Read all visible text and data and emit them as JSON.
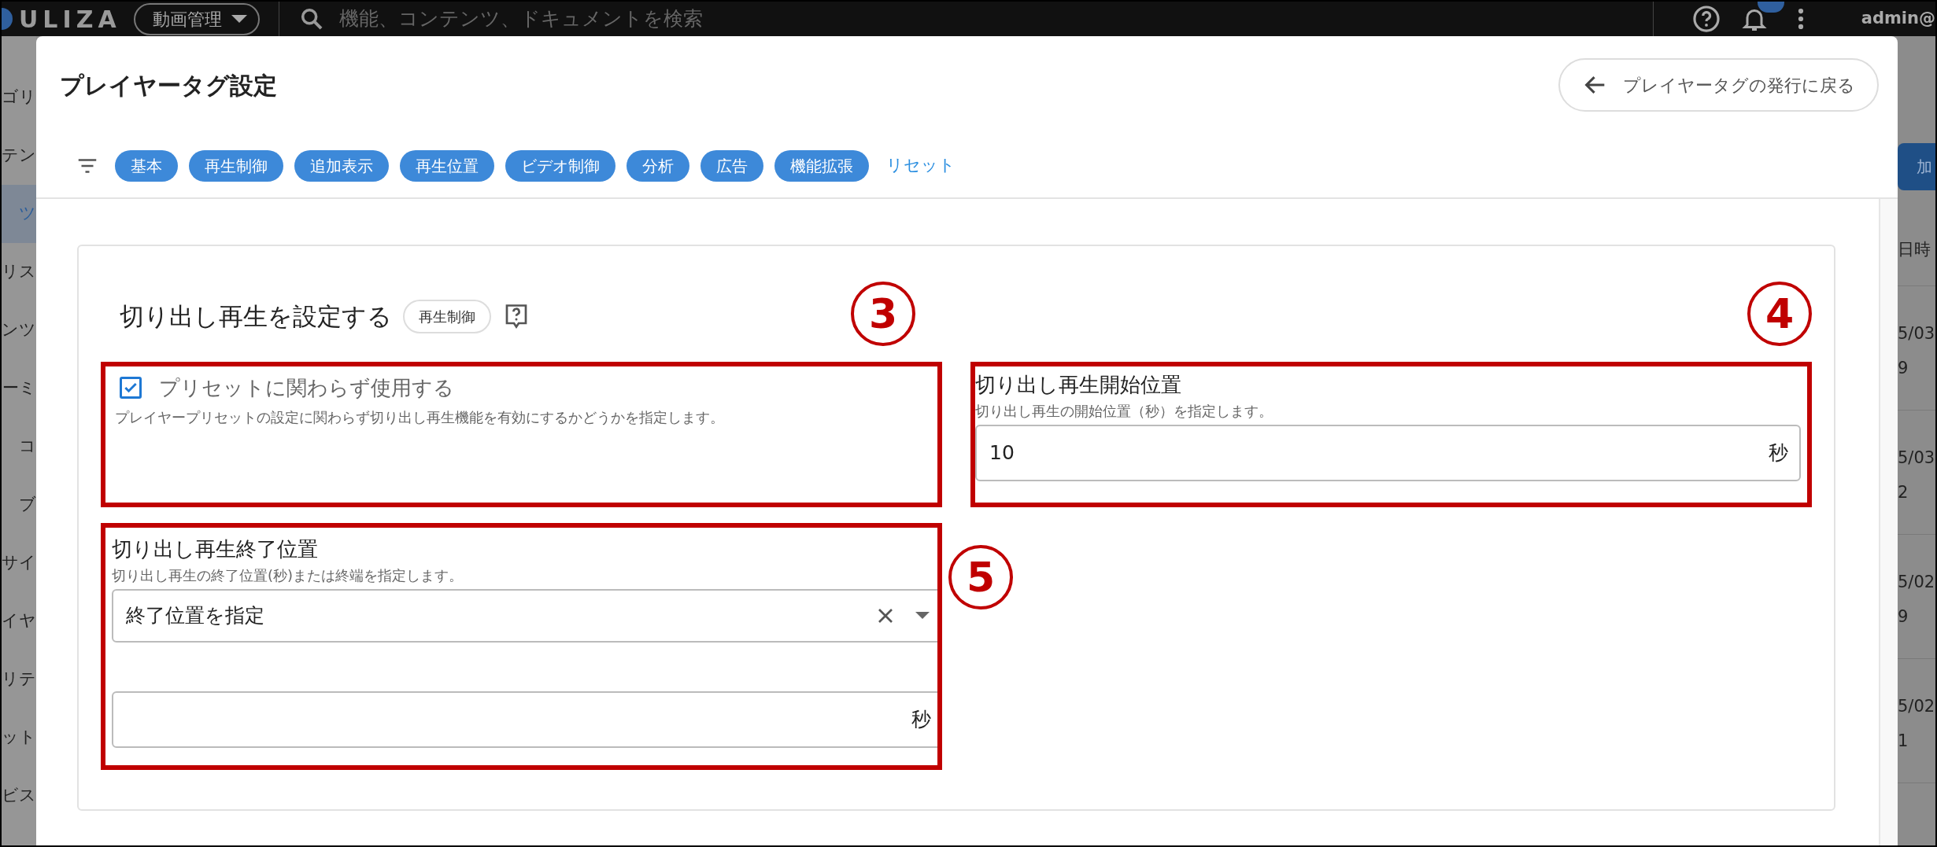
{
  "top_bar": {
    "logo": "ULIZA",
    "service_menu": "動画管理",
    "search": {
      "placeholder": "機能、コンテンツ、ドキュメントを検索"
    },
    "user": "admin@"
  },
  "sidebar": {
    "items": [
      {
        "label": "ゴリ",
        "selected": false
      },
      {
        "label": "テン",
        "selected": false
      },
      {
        "label": "ツ",
        "selected": true
      },
      {
        "label": "リス",
        "selected": false
      },
      {
        "label": "ンツ",
        "selected": false
      },
      {
        "label": "ーミ",
        "selected": false
      },
      {
        "label": "コ",
        "selected": false
      },
      {
        "label": "ブ",
        "selected": false
      },
      {
        "label": "サイ",
        "selected": false
      },
      {
        "label": "イヤ",
        "selected": false
      },
      {
        "label": "リテ",
        "selected": false
      },
      {
        "label": "ット",
        "selected": false
      },
      {
        "label": "ビス",
        "selected": false
      }
    ]
  },
  "background_table": {
    "button": "加",
    "header": "日時",
    "rows": [
      [
        "5/03",
        "9"
      ],
      [
        "5/03",
        "2"
      ],
      [
        "5/02",
        "9"
      ],
      [
        "5/02",
        "1"
      ]
    ]
  },
  "dialog": {
    "title": "プレイヤータグ設定",
    "back_button": "プレイヤータグの発行に戻る",
    "filters": [
      "基本",
      "再生制御",
      "追加表示",
      "再生位置",
      "ビデオ制御",
      "分析",
      "広告",
      "機能拡張"
    ],
    "reset": "リセット",
    "section": {
      "title": "切り出し再生を設定する",
      "tag": "再生制御",
      "fields": [
        {
          "kind": "checkbox",
          "label": "プリセットに関わらず使用する",
          "checked": true,
          "description": "プレイヤープリセットの設定に関わらず切り出し再生機能を有効にするかどうかを指定します。",
          "annotation": "3"
        },
        {
          "kind": "number",
          "label": "切り出し再生開始位置",
          "description": "切り出し再生の開始位置（秒）を指定します。",
          "value": "10",
          "unit": "秒",
          "annotation": "4"
        },
        {
          "kind": "select_number",
          "label": "切り出し再生終了位置",
          "description": "切り出し再生の終了位置(秒)または終端を指定します。",
          "select_value": "終了位置を指定",
          "unit": "秒",
          "annotation": "5"
        }
      ]
    }
  }
}
